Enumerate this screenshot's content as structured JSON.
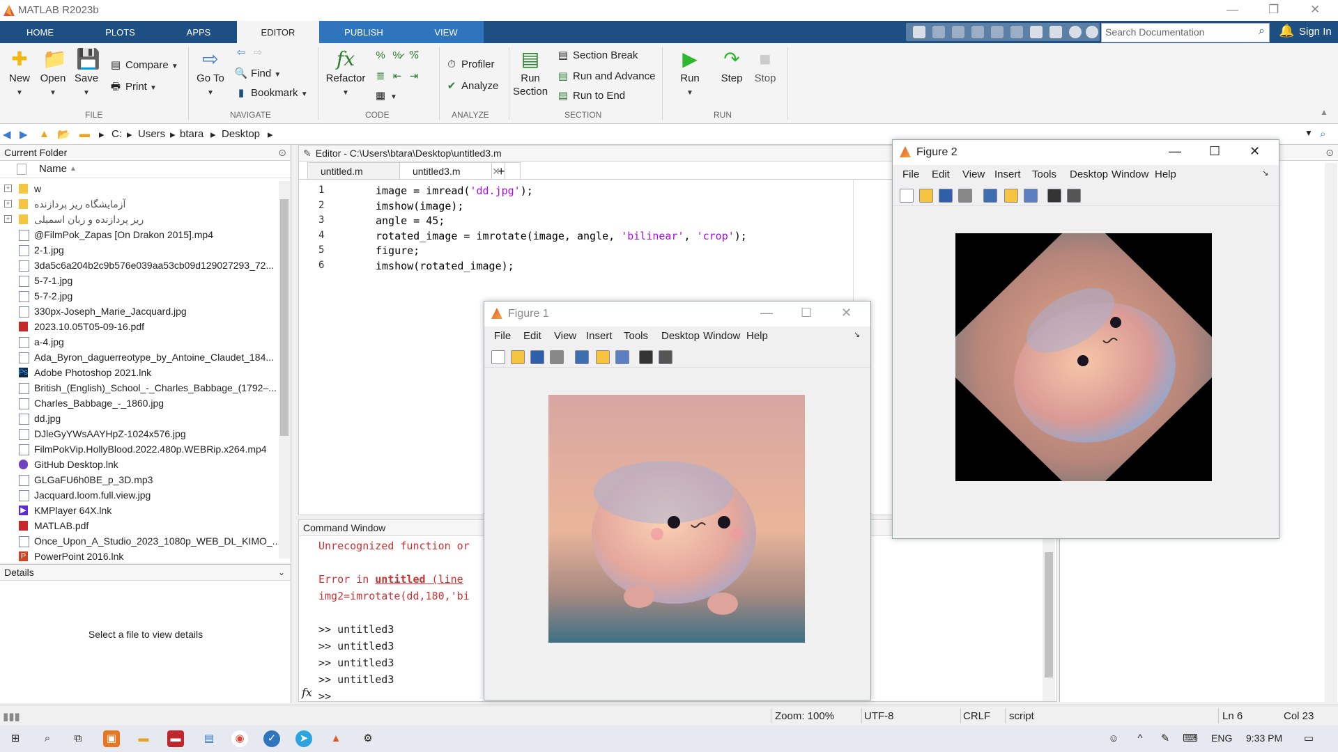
{
  "app_title": "MATLAB R2023b",
  "tabs": [
    "HOME",
    "PLOTS",
    "APPS",
    "EDITOR",
    "PUBLISH",
    "VIEW"
  ],
  "search_placeholder": "Search Documentation",
  "sign_in": "Sign In",
  "ribbon": {
    "new": "New",
    "open": "Open",
    "save": "Save",
    "compare": "Compare",
    "print": "Print",
    "file_group": "FILE",
    "goto": "Go To",
    "find": "Find",
    "bookmark": "Bookmark",
    "navigate_group": "NAVIGATE",
    "refactor": "Refactor",
    "code_group": "CODE",
    "profiler": "Profiler",
    "analyze": "Analyze",
    "analyze_group": "ANALYZE",
    "run_section_1": "Run",
    "run_section_2": "Section",
    "section_break": "Section Break",
    "run_advance": "Run and Advance",
    "run_end": "Run to End",
    "section_group": "SECTION",
    "run": "Run",
    "step": "Step",
    "stop": "Stop",
    "run_group": "RUN"
  },
  "path": [
    "C:",
    "Users",
    "btara",
    "Desktop"
  ],
  "current_folder": {
    "title": "Current Folder",
    "col_name": "Name",
    "items": [
      {
        "name": "w",
        "type": "folder"
      },
      {
        "name": "آزمایشگاه ریز پردازنده",
        "type": "folder"
      },
      {
        "name": "ریز پردازنده و زبان اسمبلی",
        "type": "folder"
      },
      {
        "name": "@FilmPok_Zapas [On Drakon 2015].mp4",
        "type": "file"
      },
      {
        "name": "2-1.jpg",
        "type": "file"
      },
      {
        "name": "3da5c6a204b2c9b576e039aa53cb09d129027293_72...",
        "type": "file"
      },
      {
        "name": "5-7-1.jpg",
        "type": "file"
      },
      {
        "name": "5-7-2.jpg",
        "type": "file"
      },
      {
        "name": "330px-Joseph_Marie_Jacquard.jpg",
        "type": "file"
      },
      {
        "name": "2023.10.05T05-09-16.pdf",
        "type": "pdf"
      },
      {
        "name": "a-4.jpg",
        "type": "file"
      },
      {
        "name": "Ada_Byron_daguerreotype_by_Antoine_Claudet_184...",
        "type": "file"
      },
      {
        "name": "Adobe Photoshop 2021.lnk",
        "type": "ps"
      },
      {
        "name": "British_(English)_School_-_Charles_Babbage_(1792–...",
        "type": "file"
      },
      {
        "name": "Charles_Babbage_-_1860.jpg",
        "type": "file"
      },
      {
        "name": "dd.jpg",
        "type": "file"
      },
      {
        "name": "DJleGyYWsAAYHpZ-1024x576.jpg",
        "type": "file"
      },
      {
        "name": "FilmPokVip.HollyBlood.2022.480p.WEBRip.x264.mp4",
        "type": "file"
      },
      {
        "name": "GitHub Desktop.lnk",
        "type": "gh"
      },
      {
        "name": "GLGaFU6h0BE_p_3D.mp3",
        "type": "file"
      },
      {
        "name": "Jacquard.loom.full.view.jpg",
        "type": "file"
      },
      {
        "name": "KMPlayer 64X.lnk",
        "type": "km"
      },
      {
        "name": "MATLAB.pdf",
        "type": "pdf"
      },
      {
        "name": "Once_Upon_A_Studio_2023_1080p_WEB_DL_KIMO_...",
        "type": "file"
      },
      {
        "name": "PowerPoint 2016.lnk",
        "type": "pp"
      }
    ]
  },
  "details": {
    "title": "Details",
    "message": "Select a file to view details"
  },
  "editor": {
    "title": "Editor - C:\\Users\\btara\\Desktop\\untitled3.m",
    "tabs": [
      "untitled.m",
      "untitled3.m"
    ],
    "line_numbers": [
      "1",
      "2",
      "3",
      "4",
      "5",
      "6"
    ],
    "lines": [
      "image = imread('dd.jpg');",
      "imshow(image);",
      "angle = 45;",
      "rotated_image = imrotate(image, angle, 'bilinear', 'crop');",
      "figure;",
      "imshow(rotated_image);"
    ]
  },
  "command_window": {
    "title": "Command Window",
    "err1": "Unrecognized function or",
    "err2_a": "Error in ",
    "err2_b": "untitled",
    "err2_c": " (line",
    "err3": "img2=imrotate(dd,180,'bi",
    "history": [
      ">> untitled3",
      ">> untitled3",
      ">> untitled3",
      ">> untitled3"
    ],
    "prompt": ">>"
  },
  "figure1": {
    "title": "Figure 1"
  },
  "figure2": {
    "title": "Figure 2"
  },
  "figure_menu": [
    "File",
    "Edit",
    "View",
    "Insert",
    "Tools",
    "Desktop",
    "Window",
    "Help"
  ],
  "status": {
    "zoom": "Zoom: 100%",
    "encoding": "UTF-8",
    "eol": "CRLF",
    "type": "script",
    "ln": "Ln  6",
    "col": "Col  23"
  },
  "taskbar": {
    "lang": "ENG",
    "time": "9:33 PM"
  }
}
